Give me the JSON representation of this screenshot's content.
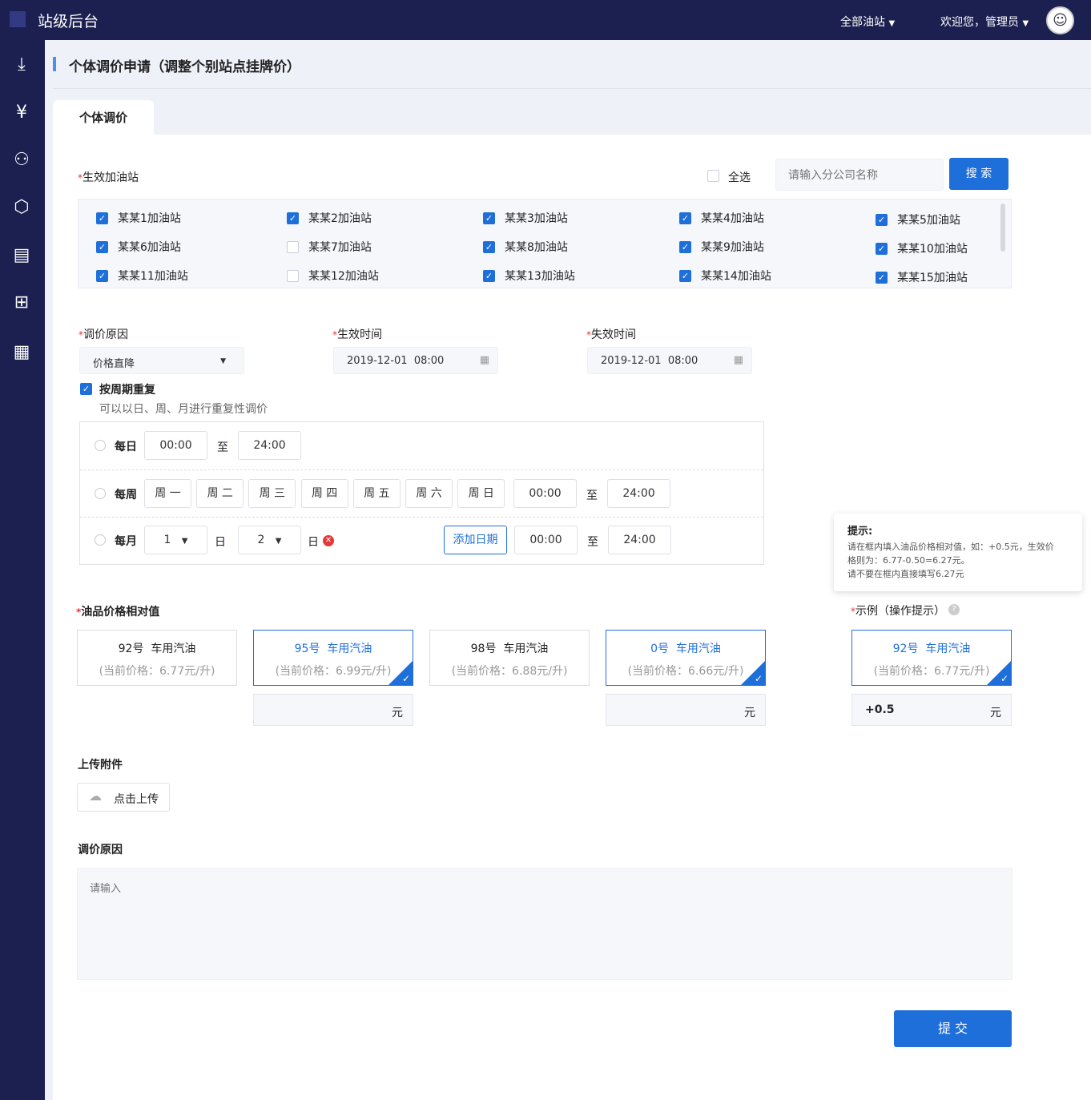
{
  "header": {
    "app_title": "站级后台",
    "station_filter": "全部油站",
    "welcome": "欢迎您，管理员"
  },
  "sidebar": {
    "icons": [
      "download-icon",
      "yen-hand-icon",
      "user-icon",
      "box-icon",
      "clipboard-icon",
      "gift-icon",
      "calculator-icon"
    ]
  },
  "page": {
    "title": "个体调价申请（调整个别站点挂牌价）",
    "tab": "个体调价"
  },
  "stations": {
    "label": "生效加油站",
    "select_all": "全选",
    "search_placeholder": "请输入分公司名称",
    "search_button": "搜 索",
    "items": [
      {
        "name": "某某1加油站",
        "checked": true
      },
      {
        "name": "某某2加油站",
        "checked": true
      },
      {
        "name": "某某3加油站",
        "checked": true
      },
      {
        "name": "某某4加油站",
        "checked": true
      },
      {
        "name": "某某5加油站",
        "checked": true
      },
      {
        "name": "某某6加油站",
        "checked": true
      },
      {
        "name": "某某7加油站",
        "checked": false
      },
      {
        "name": "某某8加油站",
        "checked": true
      },
      {
        "name": "某某9加油站",
        "checked": true
      },
      {
        "name": "某某10加油站",
        "checked": true
      },
      {
        "name": "某某11加油站",
        "checked": true
      },
      {
        "name": "某某12加油站",
        "checked": false
      },
      {
        "name": "某某13加油站",
        "checked": true
      },
      {
        "name": "某某14加油站",
        "checked": true
      },
      {
        "name": "某某15加油站",
        "checked": true
      }
    ]
  },
  "reason": {
    "label": "调价原因",
    "value": "价格直降"
  },
  "start": {
    "label": "生效时间",
    "value": "2019-12-01  08:00"
  },
  "end": {
    "label": "失效时间",
    "value": "2019-12-01  08:00"
  },
  "repeat": {
    "label": "按周期重复",
    "checked": true,
    "hint": "可以以日、周、月进行重复性调价",
    "daily": {
      "label": "每日",
      "from": "00:00",
      "to_sep": "至",
      "to": "24:00"
    },
    "weekly": {
      "label": "每周",
      "days": [
        "周 一",
        "周 二",
        "周 三",
        "周 四",
        "周 五",
        "周 六",
        "周 日"
      ],
      "from": "00:00",
      "to_sep": "至",
      "to": "24:00"
    },
    "monthly": {
      "label": "每月",
      "day1": "1",
      "day_unit": "日",
      "day2": "2",
      "add_date": "添加日期",
      "from": "00:00",
      "to_sep": "至",
      "to": "24:00"
    }
  },
  "fuel": {
    "label": "油品价格相对值",
    "unit": "元",
    "items": [
      {
        "name": "92号  车用汽油",
        "price": "(当前价格：6.77元/升)",
        "selected": false
      },
      {
        "name": "95号  车用汽油",
        "price": "(当前价格：6.99元/升)",
        "selected": true
      },
      {
        "name": "98号  车用汽油",
        "price": "(当前价格：6.88元/升)",
        "selected": false
      },
      {
        "name": "0号  车用汽油",
        "price": "(当前价格：6.66元/升)",
        "selected": true
      }
    ]
  },
  "example": {
    "label": "示例（操作提示）",
    "name": "92号  车用汽油",
    "price": "(当前价格：6.77元/升)",
    "value": "+0.5",
    "unit": "元"
  },
  "tooltip": {
    "title": "提示:",
    "lines": [
      "请在框内填入油品价格相对值，如：+0.5元，生效价",
      "格则为：6.77-0.50=6.27元。",
      "请不要在框内直接填写6.27元"
    ]
  },
  "upload": {
    "label": "上传附件",
    "button": "点击上传"
  },
  "remark": {
    "label": "调价原因",
    "placeholder": "请输入"
  },
  "submit": "提 交",
  "colors": {
    "primary": "#1e6fd9",
    "nav": "#1b2050"
  }
}
